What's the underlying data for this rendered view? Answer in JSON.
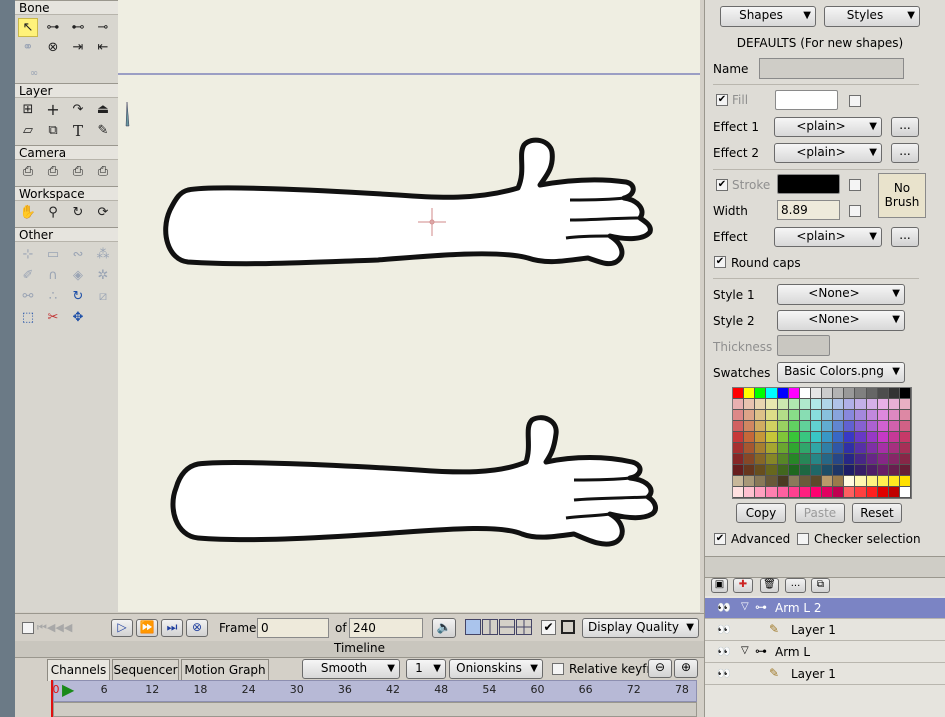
{
  "tools": {
    "sections": [
      "Bone",
      "Layer",
      "Camera",
      "Workspace",
      "Other"
    ],
    "bone_icons": [
      "select-bone-icon",
      "add-bone-icon",
      "reparent-bone-icon",
      "bone-strength-icon",
      "offset-bone-icon",
      "manipulate-bones-icon",
      "bind-layer-icon",
      "bind-points-icon",
      "transform-bone-icon"
    ],
    "layer_icons": [
      "transform-layer-icon",
      "set-origin-icon",
      "follow-path-icon",
      "rotate-layer-xy-icon",
      "shear-layer-icon",
      "switch-layer-icon",
      "text-tool-icon",
      "eyedropper-icon"
    ],
    "camera_icons": [
      "track-camera-icon",
      "zoom-camera-icon",
      "roll-camera-icon",
      "pan-tilt-camera-icon"
    ],
    "workspace_icons": [
      "hand-pan-icon",
      "zoom-workspace-icon",
      "rotate-workspace-icon",
      "orbit-workspace-icon"
    ],
    "text_tool_glyph": "T"
  },
  "style_panel": {
    "shapes_label": "Shapes",
    "styles_label": "Styles",
    "defaults_title": "DEFAULTS (For new shapes)",
    "name_label": "Name",
    "name_value": "",
    "fill_label": "Fill",
    "effect1_label": "Effect 1",
    "effect1_value": "<plain>",
    "effect2_label": "Effect 2",
    "effect2_value": "<plain>",
    "stroke_label": "Stroke",
    "width_label": "Width",
    "width_value": "8.89",
    "effect_label": "Effect",
    "effect_value": "<plain>",
    "no_brush_label": "No\nBrush",
    "round_caps_label": "Round caps",
    "style1_label": "Style 1",
    "style1_value": "<None>",
    "style2_label": "Style 2",
    "style2_value": "<None>",
    "thickness_label": "Thickness",
    "swatches_label": "Swatches",
    "swatches_value": "Basic Colors.png",
    "copy_label": "Copy",
    "paste_label": "Paste",
    "reset_label": "Reset",
    "advanced_label": "Advanced",
    "checker_label": "Checker selection",
    "ellipsis": "...",
    "fill_color": "#ffffff",
    "stroke_color": "#000000"
  },
  "layers": {
    "rows": [
      {
        "name": "Arm L 2",
        "type": "bone",
        "selected": true,
        "indent": 0
      },
      {
        "name": "Layer 1",
        "type": "vector",
        "selected": false,
        "indent": 1
      },
      {
        "name": "Arm L",
        "type": "bone",
        "selected": false,
        "indent": 0
      },
      {
        "name": "Layer 1",
        "type": "vector",
        "selected": false,
        "indent": 1
      }
    ]
  },
  "transport": {
    "frame_label": "Frame",
    "frame_value": "0",
    "of_label": "of",
    "total_frames": "240",
    "display_quality_label": "Display Quality",
    "play_icons": [
      "first-frame-icon",
      "previous-frame-icon",
      "play-icon",
      "next-frame-icon",
      "last-frame-icon",
      "loop-icon"
    ]
  },
  "timeline": {
    "title": "Timeline",
    "tabs": [
      "Channels",
      "Sequencer",
      "Motion Graph"
    ],
    "smooth_label": "Smooth",
    "step_value": "1",
    "onionskins_label": "Onionskins",
    "relative_label": "Relative keyfra",
    "ruler_ticks": [
      "0",
      "6",
      "12",
      "18",
      "24",
      "30",
      "36",
      "42",
      "48",
      "54",
      "60",
      "66",
      "72",
      "78"
    ],
    "current_frame": "0"
  },
  "colors": {
    "canvas_bg": "#efeee2",
    "selection_blue": "#7b84c4",
    "ruler_bg": "#b7b9d6",
    "playhead_red": "#e01010",
    "play_green": "#1a8a1a"
  }
}
